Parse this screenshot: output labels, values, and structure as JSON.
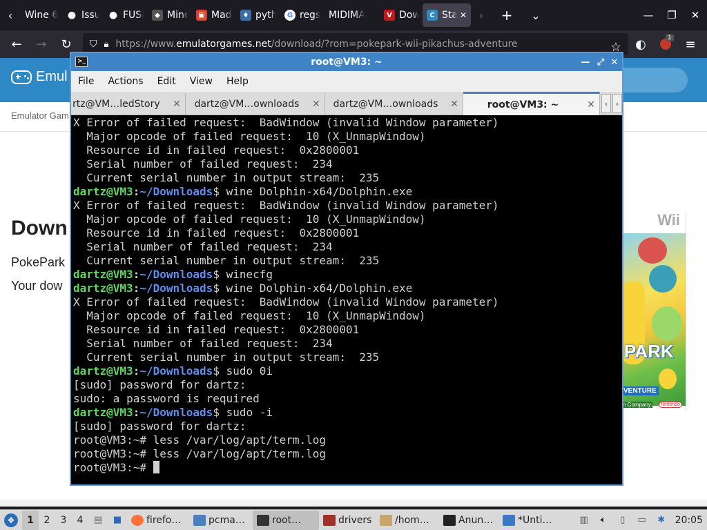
{
  "browser": {
    "tabs": [
      {
        "label": "Wine 64",
        "icon": "wine-icon"
      },
      {
        "label": "Issue",
        "icon": "github-icon"
      },
      {
        "label": "FUSE",
        "icon": "github-icon"
      },
      {
        "label": "Mine",
        "icon": "minecraft-icon"
      },
      {
        "label": "Mad",
        "icon": "mad-icon"
      },
      {
        "label": "pyth",
        "icon": "python-icon"
      },
      {
        "label": "regs",
        "icon": "google-icon"
      },
      {
        "label": "MIDIMA",
        "icon": "blank-icon"
      },
      {
        "label": "Dow",
        "icon": "v-icon"
      },
      {
        "label": "Sta",
        "icon": "emulator-icon"
      }
    ],
    "new_tab_label": "+",
    "url": {
      "prefix": "https://www.",
      "domain": "emulatorgames.net",
      "path": "/download/?rom=pokepark-wii-pikachus-adventure"
    },
    "extension_badge": "1"
  },
  "webpage": {
    "logo_text": "Emul",
    "breadcrumb": "Emulator Gam",
    "heading": "Down",
    "game_name": "PokePark",
    "download_text": "Your dow",
    "cover_platform": "Wii",
    "cover_title": "PARK",
    "cover_sub": "VENTURE",
    "cover_company": "n Company",
    "cover_brand": "Nintendo"
  },
  "terminal": {
    "title": "root@VM3: ~",
    "menu": [
      "File",
      "Actions",
      "Edit",
      "View",
      "Help"
    ],
    "tabs": [
      {
        "label": "rtz@VM…ledStory"
      },
      {
        "label": "dartz@VM…ownloads"
      },
      {
        "label": "dartz@VM…ownloads"
      },
      {
        "label": "root@VM3: ~"
      }
    ],
    "lines": [
      {
        "out": "X Error of failed request:  BadWindow (invalid Window parameter)"
      },
      {
        "out": "  Major opcode of failed request:  10 (X_UnmapWindow)"
      },
      {
        "out": "  Resource id in failed request:  0x2800001"
      },
      {
        "out": "  Serial number of failed request:  234"
      },
      {
        "out": "  Current serial number in output stream:  235"
      },
      {
        "user": "dartz@VM3",
        "path": "~/Downloads",
        "cmd": "$ wine Dolphin-x64/Dolphin.exe"
      },
      {
        "out": "X Error of failed request:  BadWindow (invalid Window parameter)"
      },
      {
        "out": "  Major opcode of failed request:  10 (X_UnmapWindow)"
      },
      {
        "out": "  Resource id in failed request:  0x2800001"
      },
      {
        "out": "  Serial number of failed request:  234"
      },
      {
        "out": "  Current serial number in output stream:  235"
      },
      {
        "user": "dartz@VM3",
        "path": "~/Downloads",
        "cmd": "$ winecfg"
      },
      {
        "user": "dartz@VM3",
        "path": "~/Downloads",
        "cmd": "$ wine Dolphin-x64/Dolphin.exe"
      },
      {
        "out": "X Error of failed request:  BadWindow (invalid Window parameter)"
      },
      {
        "out": "  Major opcode of failed request:  10 (X_UnmapWindow)"
      },
      {
        "out": "  Resource id in failed request:  0x2800001"
      },
      {
        "out": "  Serial number of failed request:  234"
      },
      {
        "out": "  Current serial number in output stream:  235"
      },
      {
        "user": "dartz@VM3",
        "path": "~/Downloads",
        "cmd": "$ sudo 0i"
      },
      {
        "out": "[sudo] password for dartz:"
      },
      {
        "out": "sudo: a password is required"
      },
      {
        "user": "dartz@VM3",
        "path": "~/Downloads",
        "cmd": "$ sudo -i"
      },
      {
        "out": "[sudo] password for dartz:"
      },
      {
        "out": "root@VM3:~# less /var/log/apt/term.log"
      },
      {
        "out": "root@VM3:~# less /var/log/apt/term.log"
      },
      {
        "out": "root@VM3:~# ",
        "cursor": true
      }
    ]
  },
  "taskbar": {
    "workspaces": [
      "1",
      "2",
      "3",
      "4"
    ],
    "tasks": [
      {
        "label": "firefo…",
        "icon": "firefox-icon",
        "color": "#ff7139"
      },
      {
        "label": "pcma…",
        "icon": "folder-icon",
        "color": "#4a7fc1"
      },
      {
        "label": "root…",
        "icon": "terminal-icon",
        "color": "#333333"
      },
      {
        "label": "drivers",
        "icon": "wine-glass-icon",
        "color": "#a0302a"
      },
      {
        "label": "/hom…",
        "icon": "archive-icon",
        "color": "#c9a46b"
      },
      {
        "label": "Anun…",
        "icon": "ghost-icon",
        "color": "#222222"
      },
      {
        "label": "*Unti…",
        "icon": "text-editor-icon",
        "color": "#3c78c8"
      }
    ],
    "clock": "20:05"
  }
}
